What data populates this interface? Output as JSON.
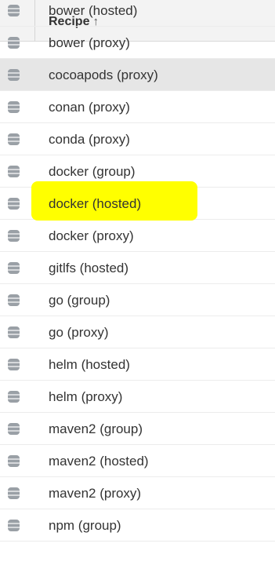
{
  "table": {
    "header": {
      "column": "Recipe",
      "sort_indicator": "↑"
    },
    "rows": [
      {
        "label": "bower (hosted)"
      },
      {
        "label": "bower (proxy)"
      },
      {
        "label": "cocoapods (proxy)"
      },
      {
        "label": "conan (proxy)"
      },
      {
        "label": "conda (proxy)"
      },
      {
        "label": "docker (group)"
      },
      {
        "label": "docker (hosted)"
      },
      {
        "label": "docker (proxy)"
      },
      {
        "label": "gitlfs (hosted)"
      },
      {
        "label": "go (group)"
      },
      {
        "label": "go (proxy)"
      },
      {
        "label": "helm (hosted)"
      },
      {
        "label": "helm (proxy)"
      },
      {
        "label": "maven2 (group)"
      },
      {
        "label": "maven2 (hosted)"
      },
      {
        "label": "maven2 (proxy)"
      },
      {
        "label": "npm (group)"
      }
    ],
    "selected_row": "cocoapods (proxy)",
    "highlighted_row": "docker (hosted)",
    "icon": "database-icon",
    "colors": {
      "highlight": "#ffff00",
      "selected": "#e6e6e6",
      "icon": "#9aa0a6"
    }
  }
}
